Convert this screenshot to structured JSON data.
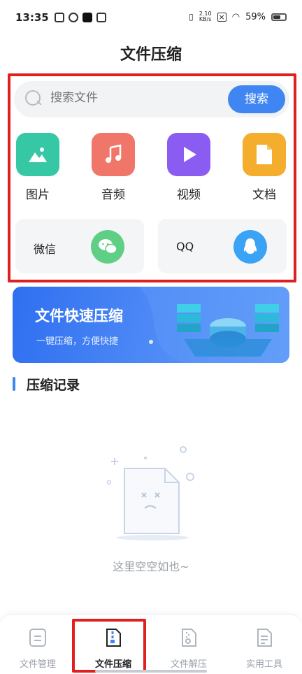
{
  "status_bar": {
    "time": "13:35",
    "net_speed_top": "2.10",
    "net_speed_bottom": "KB/s",
    "battery": "59%"
  },
  "header": {
    "title": "文件压缩"
  },
  "search": {
    "placeholder": "搜索文件",
    "button_label": "搜索"
  },
  "categories": [
    {
      "label": "图片",
      "icon": "image-icon",
      "color": "#36c8a4"
    },
    {
      "label": "音频",
      "icon": "music-icon",
      "color": "#f0766a"
    },
    {
      "label": "视频",
      "icon": "video-icon",
      "color": "#8a5cf2"
    },
    {
      "label": "文档",
      "icon": "document-icon",
      "color": "#f4ad2c"
    }
  ],
  "share_sources": [
    {
      "label": "微信",
      "icon": "wechat-icon",
      "color": "#5fcf86"
    },
    {
      "label": "QQ",
      "icon": "qq-icon",
      "color": "#3aa3f5"
    }
  ],
  "banner": {
    "title": "文件快速压缩",
    "subtitle": "一键压缩，方便快捷"
  },
  "records": {
    "section_title": "压缩记录",
    "empty_text": "这里空空如也~"
  },
  "bottom_nav": [
    {
      "label": "文件管理",
      "icon": "file-manage-icon",
      "active": false
    },
    {
      "label": "文件压缩",
      "icon": "file-compress-icon",
      "active": true
    },
    {
      "label": "文件解压",
      "icon": "file-extract-icon",
      "active": false
    },
    {
      "label": "实用工具",
      "icon": "tools-icon",
      "active": false
    }
  ],
  "colors": {
    "accent": "#3f86f3",
    "highlight": "#e02020"
  }
}
